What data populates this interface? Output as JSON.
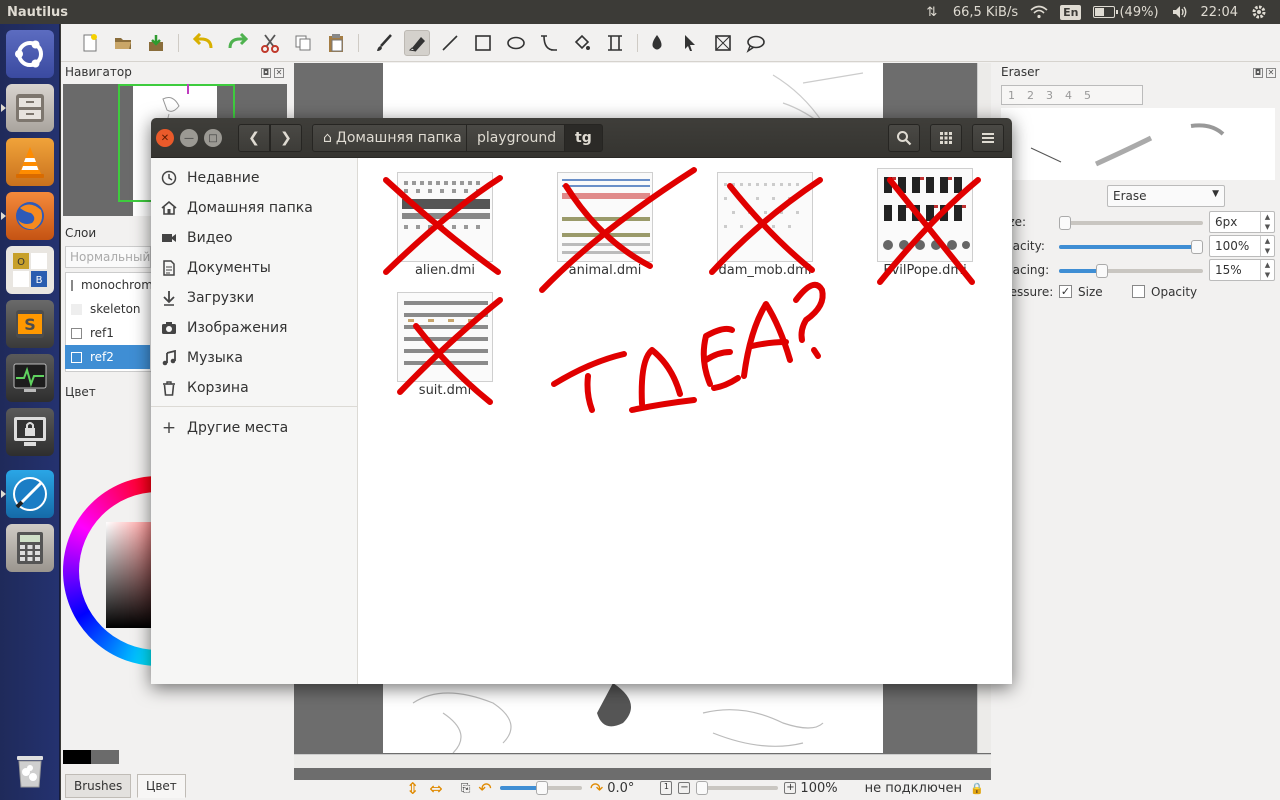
{
  "top_panel": {
    "app_name": "Nautilus",
    "net_speed": "66,5 KiB/s",
    "keyboard_layout": "En",
    "battery": "(49%)",
    "battery_level": 0.49,
    "time": "22:04"
  },
  "launcher": {
    "items": [
      {
        "name": "ubuntu-dash",
        "icon": "ubuntu-logo-icon"
      },
      {
        "name": "files",
        "icon": "file-cabinet-icon"
      },
      {
        "name": "vlc",
        "icon": "traffic-cone-icon"
      },
      {
        "name": "firefox",
        "icon": "firefox-icon"
      },
      {
        "name": "libreoffice",
        "icon": "office-grid-icon"
      },
      {
        "name": "sublime-text",
        "icon": "sublime-s-icon"
      },
      {
        "name": "system-monitor",
        "icon": "pulse-monitor-icon"
      },
      {
        "name": "screen-lock",
        "icon": "padlock-monitor-icon"
      },
      {
        "name": "mypaint",
        "icon": "paintbrush-circle-icon"
      },
      {
        "name": "calculator",
        "icon": "calculator-icon"
      },
      {
        "name": "trash",
        "icon": "trash-icon"
      }
    ]
  },
  "mypaint": {
    "navigator_title": "Навигатор",
    "layers_title": "Слои",
    "blend_mode_placeholder": "Нормальный",
    "layers": [
      "monochrome",
      "skeleton",
      "ref1",
      "ref2"
    ],
    "color_title": "Цвет",
    "tabs": {
      "brushes": "Brushes",
      "color": "Цвет"
    },
    "right_panel": {
      "title": "Eraser",
      "preset_numbers": [
        "1",
        "2",
        "3",
        "4",
        "5"
      ],
      "mode_value": "Erase",
      "size_label": "ize:",
      "size_value": "6px",
      "size_level": 0.04,
      "opacity_label": "pacity:",
      "opacity_value": "100%",
      "opacity_level": 1.0,
      "spacing_label": "pacing:",
      "spacing_value": "15%",
      "spacing_level": 0.3,
      "pressure_label": "ressure:",
      "pressure_size_label": "Size",
      "pressure_opacity_label": "Opacity"
    },
    "status": {
      "rotation": "0.0°",
      "zoom": "100%",
      "connection": "не подключен"
    }
  },
  "nautilus": {
    "breadcrumbs": {
      "home": "Домашняя папка",
      "playground": "playground",
      "current": "tg"
    },
    "sidebar": [
      {
        "label": "Недавние",
        "icon": "clock-icon"
      },
      {
        "label": "Домашняя папка",
        "icon": "home-icon"
      },
      {
        "label": "Видео",
        "icon": "video-icon"
      },
      {
        "label": "Документы",
        "icon": "document-icon"
      },
      {
        "label": "Загрузки",
        "icon": "download-icon"
      },
      {
        "label": "Изображения",
        "icon": "camera-icon"
      },
      {
        "label": "Музыка",
        "icon": "music-icon"
      },
      {
        "label": "Корзина",
        "icon": "trash-icon"
      }
    ],
    "other_places": "Другие места",
    "files": [
      {
        "name": "alien.dmi"
      },
      {
        "name": "animal.dmi"
      },
      {
        "name": "dam_mob.dmi"
      },
      {
        "name": "EvilPope.dmi"
      },
      {
        "name": "suit.dmi"
      }
    ]
  },
  "annotation": {
    "text": "ГДЕА?",
    "color": "#e00000"
  }
}
